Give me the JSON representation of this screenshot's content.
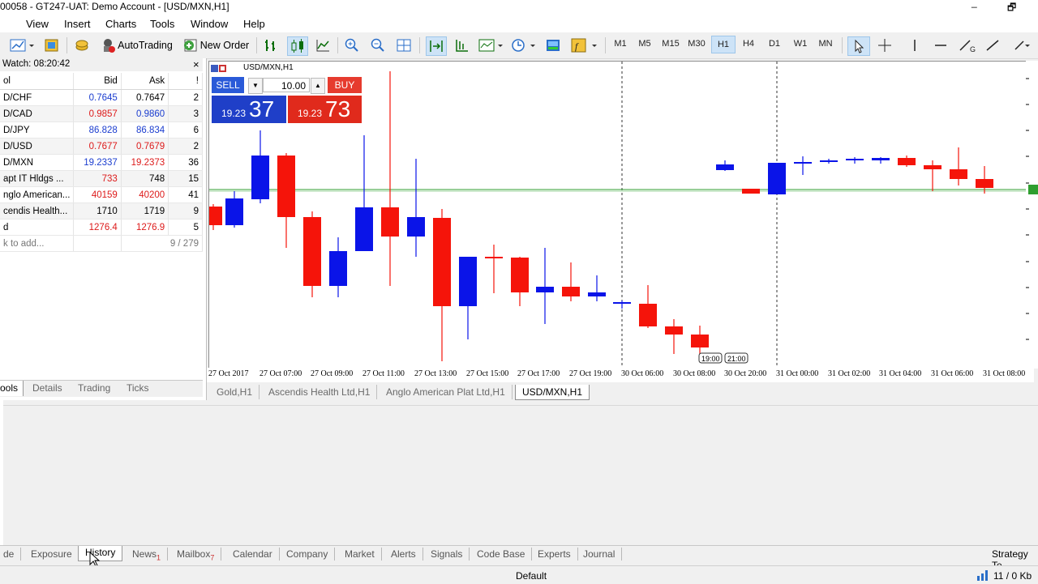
{
  "window": {
    "title": "00058 - GT247-UAT: Demo Account - [USD/MXN,H1]",
    "minimize_glyph": "_",
    "restore_glyph": "🗗"
  },
  "menu": [
    "View",
    "Insert",
    "Charts",
    "Tools",
    "Window",
    "Help"
  ],
  "toolbar": {
    "autotrading_label": "AutoTrading",
    "new_order_label": "New Order",
    "timeframes": [
      "M1",
      "M5",
      "M15",
      "M30",
      "H1",
      "H4",
      "D1",
      "W1",
      "MN"
    ],
    "active_timeframe": "H1"
  },
  "market_watch": {
    "header": "Watch: 08:20:42",
    "close_glyph": "×",
    "columns": [
      "ol",
      "Bid",
      "Ask",
      "!"
    ],
    "rows": [
      {
        "symbol": "D/CHF",
        "bid": "0.7645",
        "ask": "0.7647",
        "spread": "2",
        "bid_color": "blue",
        "ask_color": "black"
      },
      {
        "symbol": "D/CAD",
        "bid": "0.9857",
        "ask": "0.9860",
        "spread": "3",
        "bid_color": "red",
        "ask_color": "blue"
      },
      {
        "symbol": "D/JPY",
        "bid": "86.828",
        "ask": "86.834",
        "spread": "6",
        "bid_color": "blue",
        "ask_color": "blue"
      },
      {
        "symbol": "D/USD",
        "bid": "0.7677",
        "ask": "0.7679",
        "spread": "2",
        "bid_color": "red",
        "ask_color": "red"
      },
      {
        "symbol": "D/MXN",
        "bid": "19.2337",
        "ask": "19.2373",
        "spread": "36",
        "bid_color": "blue",
        "ask_color": "red"
      },
      {
        "symbol": "apt IT Hldgs ...",
        "bid": "733",
        "ask": "748",
        "spread": "15",
        "bid_color": "red",
        "ask_color": "black"
      },
      {
        "symbol": "nglo American...",
        "bid": "40159",
        "ask": "40200",
        "spread": "41",
        "bid_color": "red",
        "ask_color": "red"
      },
      {
        "symbol": "cendis Health...",
        "bid": "1710",
        "ask": "1719",
        "spread": "9",
        "bid_color": "black",
        "ask_color": "black"
      },
      {
        "symbol": "d",
        "bid": "1276.4",
        "ask": "1276.9",
        "spread": "5",
        "bid_color": "red",
        "ask_color": "red"
      }
    ],
    "add_hint": "k to add...",
    "count": "9 / 279",
    "tabs": [
      "ools",
      "Details",
      "Trading",
      "Ticks"
    ],
    "active_tab": "ools"
  },
  "one_click": {
    "symbol_label": "USD/MXN,H1",
    "sell_label": "SELL",
    "buy_label": "BUY",
    "volume": "10.00",
    "sell_price_prefix": "19.23",
    "sell_price_big": "37",
    "buy_price_prefix": "19.23",
    "buy_price_big": "73"
  },
  "chart": {
    "time_labels": [
      "27 Oct 2017",
      "27 Oct 07:00",
      "27 Oct 09:00",
      "27 Oct 11:00",
      "27 Oct 13:00",
      "27 Oct 15:00",
      "27 Oct 17:00",
      "27 Oct 19:00",
      "30 Oct 06:00",
      "30 Oct 08:00",
      "30 Oct 20:00",
      "31 Oct 00:00",
      "31 Oct 02:00",
      "31 Oct 04:00",
      "31 Oct 06:00",
      "31 Oct 08:00"
    ],
    "gap_labels": [
      "19:00",
      "21:00"
    ],
    "colors": {
      "bull": "#0a14e8",
      "bear": "#f5140a",
      "bid_line": "#2f9e2f"
    }
  },
  "chart_tabs": [
    "Gold,H1",
    "Ascendis Health Ltd,H1",
    "Anglo American Plat Ltd,H1",
    "USD/MXN,H1"
  ],
  "active_chart_tab": "USD/MXN,H1",
  "terminal_tabs": [
    {
      "label": "de",
      "badge": ""
    },
    {
      "label": "Exposure",
      "badge": ""
    },
    {
      "label": "History",
      "badge": ""
    },
    {
      "label": "News",
      "badge": "1"
    },
    {
      "label": "Mailbox",
      "badge": "7"
    },
    {
      "label": "Calendar",
      "badge": ""
    },
    {
      "label": "Company",
      "badge": ""
    },
    {
      "label": "Market",
      "badge": ""
    },
    {
      "label": "Alerts",
      "badge": ""
    },
    {
      "label": "Signals",
      "badge": ""
    },
    {
      "label": "Code Base",
      "badge": ""
    },
    {
      "label": "Experts",
      "badge": ""
    },
    {
      "label": "Journal",
      "badge": ""
    }
  ],
  "active_terminal_tab": "History",
  "strategy_tester_label": "Strategy Te",
  "status": {
    "profile": "Default",
    "traffic": "11 / 0 Kb"
  }
}
